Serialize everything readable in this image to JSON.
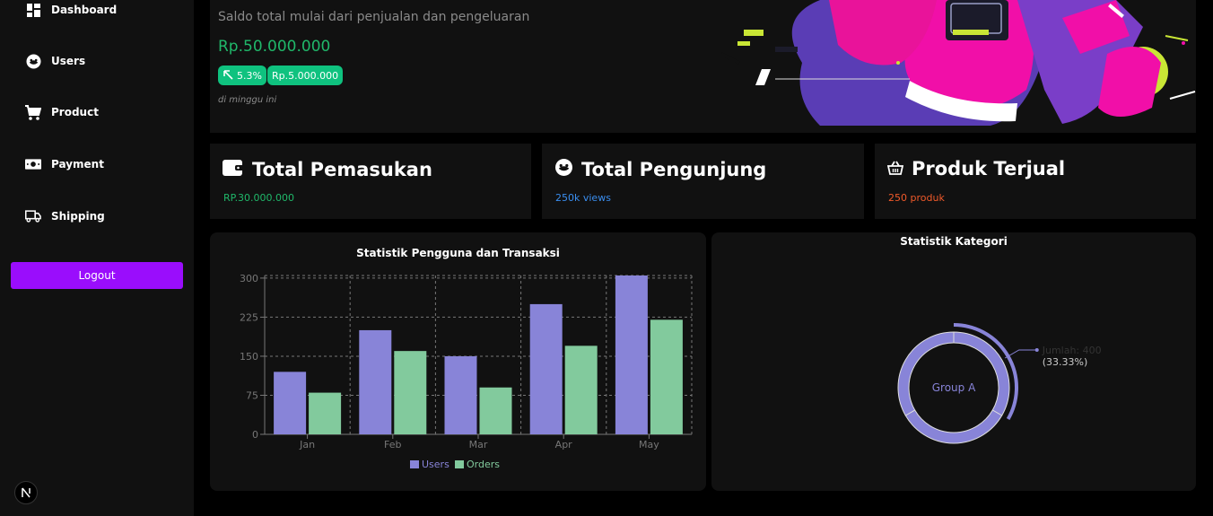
{
  "sidebar": {
    "items": [
      {
        "label": "Dashboard",
        "icon": "dashboard-icon"
      },
      {
        "label": "Users",
        "icon": "face-icon"
      },
      {
        "label": "Product",
        "icon": "cart-icon"
      },
      {
        "label": "Payment",
        "icon": "cash-icon"
      },
      {
        "label": "Shipping",
        "icon": "truck-icon"
      }
    ],
    "logout_label": "Logout"
  },
  "hero": {
    "subtitle": "Saldo total mulai dari penjualan dan pengeluaran",
    "amount": "Rp.50.000.000",
    "growth_pill": "5.3%",
    "growth_amount": "Rp.5.000.000",
    "note": "di minggu ini"
  },
  "cards": [
    {
      "title": "Total Pemasukan",
      "value": "RP.30.000.000",
      "value_color": "#20b86a",
      "icon": "wallet-icon"
    },
    {
      "title": "Total Pengunjung",
      "value": "250k views",
      "value_color": "#3a8ef0",
      "icon": "face-icon"
    },
    {
      "title": "Produk Terjual",
      "value": "250 produk",
      "value_color": "#f05a2a",
      "icon": "basket-icon"
    }
  ],
  "bar_panel": {
    "title": "Statistik Pengguna dan Transaksi"
  },
  "donut_panel": {
    "title": "Statistik Kategori",
    "center_label": "Group A",
    "tooltip_line1": "Jumlah: 400",
    "tooltip_line2": "(33.33%)"
  },
  "colors": {
    "accent": "#9a0dfc",
    "users": "#8884d8",
    "orders": "#82ca9d",
    "green": "#0fc27f"
  },
  "chart_data": [
    {
      "type": "bar",
      "title": "Statistik Pengguna dan Transaksi",
      "categories": [
        "Jan",
        "Feb",
        "Mar",
        "Apr",
        "May"
      ],
      "series": [
        {
          "name": "Users",
          "values": [
            120,
            200,
            150,
            250,
            305
          ]
        },
        {
          "name": "Orders",
          "values": [
            80,
            160,
            90,
            170,
            220
          ]
        }
      ],
      "yticks": [
        0,
        75,
        150,
        225,
        300
      ],
      "ylim": [
        0,
        305
      ],
      "grid": true,
      "legend": "bottom"
    },
    {
      "type": "pie",
      "title": "Statistik Kategori",
      "slices": [
        {
          "name": "Group A",
          "value": 400,
          "percent": 33.33
        },
        {
          "name": "",
          "value": 400
        },
        {
          "name": "",
          "value": 400
        }
      ]
    }
  ]
}
